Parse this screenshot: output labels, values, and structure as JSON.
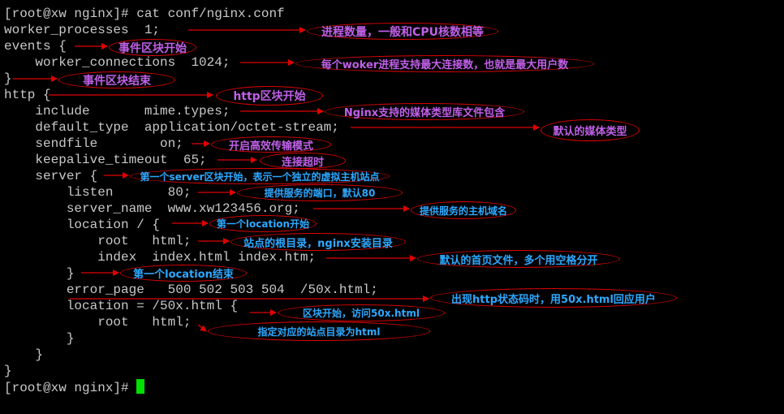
{
  "theme": {
    "background": "#000000",
    "text": "#c8c8c8",
    "cursor": "#00e000",
    "annotation_border": "#e00000",
    "annotation_purple": "#c060e8",
    "annotation_blue": "#2ea8ff"
  },
  "terminal": {
    "prompt_cmd": "[root@xw nginx]# cat conf/nginx.conf",
    "lines": [
      "worker_processes  1;",
      "events {",
      "    worker_connections  1024;",
      "}",
      "http {",
      "    include       mime.types;",
      "    default_type  application/octet-stream;",
      "    sendfile        on;",
      "    keepalive_timeout  65;",
      "    server {",
      "        listen       80;",
      "        server_name  www.xw123456.org;",
      "        location / {",
      "            root   html;",
      "            index  index.html index.htm;",
      "        }",
      "        error_page   500 502 503 504  /50x.html;",
      "        location = /50x.html {",
      "            root   html;",
      "        }",
      "    }",
      "}"
    ],
    "final_prompt": "[root@xw nginx]# "
  },
  "annotations": [
    "进程数量，一般和CPU核数相等",
    "事件区块开始",
    "每个woker进程支持最大连接数，也就是最大用户数",
    "事件区块结束",
    "http区块开始",
    "Nginx支持的媒体类型库文件包含",
    "默认的媒体类型",
    "开启高效传输模式",
    "连接超时",
    "第一个server区块开始，表示一个独立的虚拟主机站点",
    "提供服务的端口，默认80",
    "提供服务的主机域名",
    "第一个location开始",
    "站点的根目录，nginx安装目录",
    "默认的首页文件，多个用空格分开",
    "第一个location结束",
    "出现http状态码时，用50x.html回应用户",
    "区块开始，访问50x.html",
    "指定对应的站点目录为html"
  ]
}
